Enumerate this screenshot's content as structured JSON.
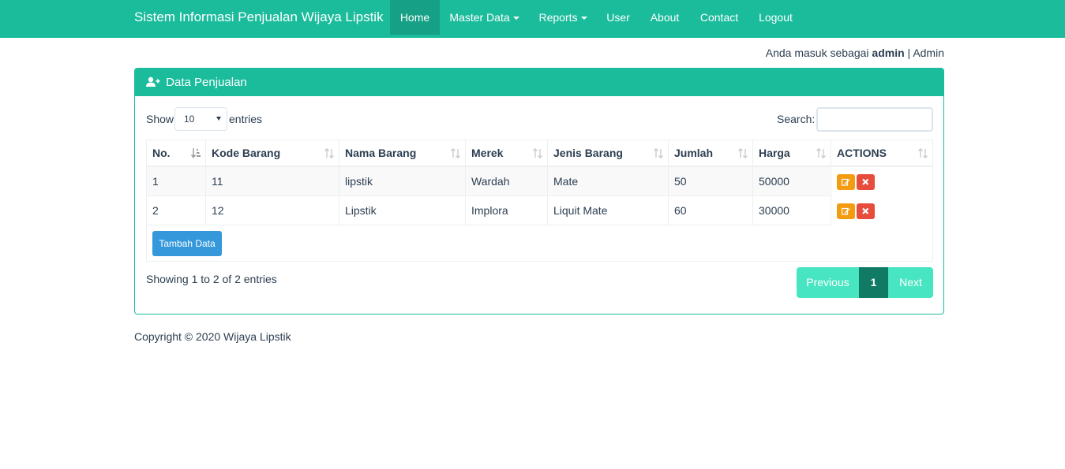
{
  "app": {
    "title": "Sistem Informasi Penjualan Wijaya Lipstik",
    "accent_color": "#1abc9c"
  },
  "nav": {
    "items": [
      {
        "label": "Home",
        "active": true
      },
      {
        "label": "Master Data",
        "dropdown": true
      },
      {
        "label": "Reports",
        "dropdown": true
      },
      {
        "label": "User"
      },
      {
        "label": "About"
      },
      {
        "label": "Contact"
      },
      {
        "label": "Logout"
      }
    ]
  },
  "login": {
    "prefix": "Anda masuk sebagai",
    "user": "admin",
    "separator": "|",
    "role": "Admin"
  },
  "panel": {
    "icon": "user-plus-icon",
    "title": "Data Penjualan"
  },
  "controls": {
    "show_label": "Show",
    "entries_value": "10",
    "entries_label": "entries",
    "search_label": "Search:",
    "search_value": ""
  },
  "table": {
    "columns": [
      "No.",
      "Kode Barang",
      "Nama Barang",
      "Merek",
      "Jenis Barang",
      "Jumlah",
      "Harga",
      "ACTIONS"
    ],
    "rows": [
      {
        "no": "1",
        "kode": "11",
        "nama": "lipstik",
        "merek": "Wardah",
        "jenis": "Mate",
        "jumlah": "50",
        "harga": "50000"
      },
      {
        "no": "2",
        "kode": "12",
        "nama": "Lipstik",
        "merek": "Implora",
        "jenis": "Liquit Mate",
        "jumlah": "60",
        "harga": "30000"
      }
    ],
    "add_button": "Tambah Data"
  },
  "pagination": {
    "info": "Showing 1 to 2 of 2 entries",
    "previous": "Previous",
    "current": "1",
    "next": "Next"
  },
  "footer": {
    "text": "Copyright © 2020 Wijaya Lipstik"
  }
}
